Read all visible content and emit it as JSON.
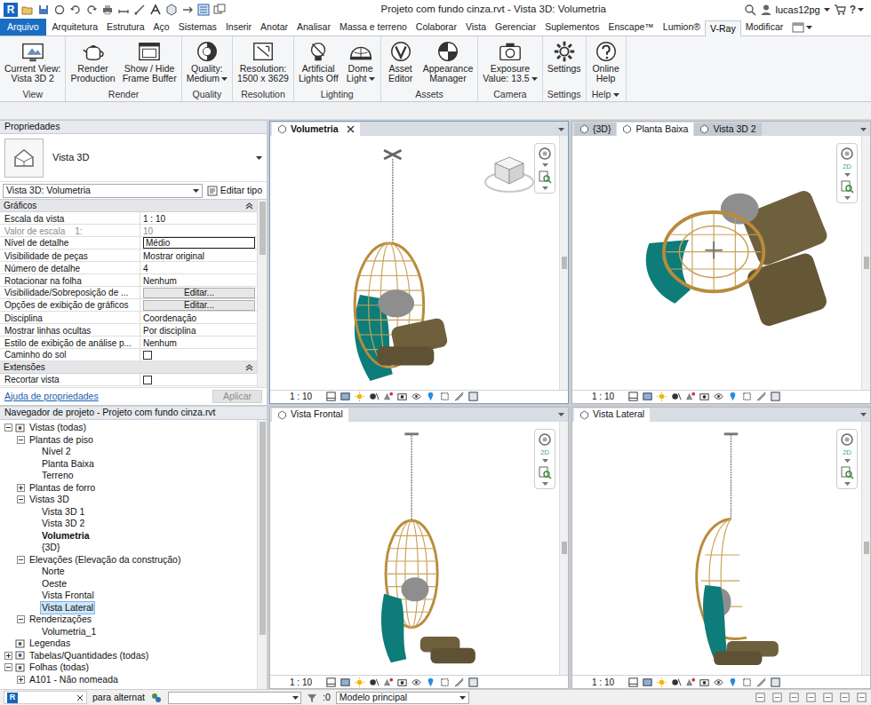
{
  "app": {
    "logo": "R"
  },
  "window": {
    "title": "Projeto com fundo cinza.rvt - Vista 3D: Volumetria",
    "user": "lucas12pg",
    "help": "?"
  },
  "ribbon_tabs": [
    {
      "label": "Arquivo",
      "selected": false,
      "kind": "file"
    },
    {
      "label": "Arquitetura",
      "selected": false,
      "kind": "tab"
    },
    {
      "label": "Estrutura",
      "selected": false,
      "kind": "tab"
    },
    {
      "label": "Aço",
      "selected": false,
      "kind": "tab"
    },
    {
      "label": "Sistemas",
      "selected": false,
      "kind": "tab"
    },
    {
      "label": "Inserir",
      "selected": false,
      "kind": "tab"
    },
    {
      "label": "Anotar",
      "selected": false,
      "kind": "tab"
    },
    {
      "label": "Analisar",
      "selected": false,
      "kind": "tab"
    },
    {
      "label": "Massa e terreno",
      "selected": false,
      "kind": "tab"
    },
    {
      "label": "Colaborar",
      "selected": false,
      "kind": "tab"
    },
    {
      "label": "Vista",
      "selected": false,
      "kind": "tab"
    },
    {
      "label": "Gerenciar",
      "selected": false,
      "kind": "tab"
    },
    {
      "label": "Suplementos",
      "selected": false,
      "kind": "tab"
    },
    {
      "label": "Enscape™",
      "selected": false,
      "kind": "tab"
    },
    {
      "label": "Lumion®",
      "selected": false,
      "kind": "tab"
    },
    {
      "label": "V-Ray",
      "selected": true,
      "kind": "tab"
    },
    {
      "label": "Modificar",
      "selected": false,
      "kind": "tab"
    }
  ],
  "ribbon_panels": [
    {
      "title": "View",
      "title_dropdown": false,
      "buttons": [
        {
          "lines": [
            "Current View:",
            "Vista 3D 2"
          ],
          "dropdown": false
        }
      ]
    },
    {
      "title": "Render",
      "title_dropdown": false,
      "buttons": [
        {
          "lines": [
            "Render",
            "Production"
          ],
          "dropdown": false
        },
        {
          "lines": [
            "Show / Hide",
            "Frame Buffer"
          ],
          "dropdown": false
        }
      ]
    },
    {
      "title": "Quality",
      "title_dropdown": false,
      "buttons": [
        {
          "lines": [
            "Quality:",
            "Medium"
          ],
          "dropdown": true
        }
      ]
    },
    {
      "title": "Resolution",
      "title_dropdown": false,
      "buttons": [
        {
          "lines": [
            "Resolution:",
            "1500 x 3629"
          ],
          "dropdown": false
        }
      ]
    },
    {
      "title": "Lighting",
      "title_dropdown": false,
      "buttons": [
        {
          "lines": [
            "Artificial",
            "Lights Off"
          ],
          "dropdown": false
        },
        {
          "lines": [
            "Dome",
            "Light"
          ],
          "dropdown": true
        }
      ]
    },
    {
      "title": "Assets",
      "title_dropdown": false,
      "buttons": [
        {
          "lines": [
            "Asset",
            "Editor"
          ],
          "dropdown": false
        },
        {
          "lines": [
            "Appearance",
            "Manager"
          ],
          "dropdown": false
        }
      ]
    },
    {
      "title": "Camera",
      "title_dropdown": false,
      "buttons": [
        {
          "lines": [
            "Exposure",
            "Value: 13.5"
          ],
          "dropdown": true
        }
      ]
    },
    {
      "title": "Settings",
      "title_dropdown": false,
      "buttons": [
        {
          "lines": [
            "Settings"
          ],
          "dropdown": false
        }
      ]
    },
    {
      "title": "Help",
      "title_dropdown": true,
      "buttons": [
        {
          "lines": [
            "Online",
            "Help"
          ],
          "dropdown": false
        }
      ]
    }
  ],
  "properties": {
    "title": "Propriedades",
    "type": "Vista 3D",
    "selector": "Vista 3D: Volumetria",
    "edit_type": "Editar tipo",
    "sections": [
      {
        "title": "Gráficos",
        "expanded": true,
        "rows": [
          {
            "label": "Escala da vista",
            "value": "1 : 10",
            "kind": "text",
            "disabled": false
          },
          {
            "label": "Valor de escala    1:",
            "value": "10",
            "kind": "text",
            "disabled": true
          },
          {
            "label": "Nível de detalhe",
            "value": "Médio",
            "kind": "edit",
            "disabled": false
          },
          {
            "label": "Visibilidade de peças",
            "value": "Mostrar original",
            "kind": "text",
            "disabled": false
          },
          {
            "label": "Número de detalhe",
            "value": "4",
            "kind": "text",
            "disabled": false
          },
          {
            "label": "Rotacionar na folha",
            "value": "Nenhum",
            "kind": "text",
            "disabled": false
          },
          {
            "label": "Visibilidade/Sobreposição de ...",
            "value": "Editar...",
            "kind": "button",
            "disabled": false
          },
          {
            "label": "Opções de exibição de gráficos",
            "value": "Editar...",
            "kind": "button",
            "disabled": false
          },
          {
            "label": "Disciplina",
            "value": "Coordenação",
            "kind": "text",
            "disabled": false
          },
          {
            "label": "Mostrar linhas ocultas",
            "value": "Por disciplina",
            "kind": "text",
            "disabled": false
          },
          {
            "label": "Estilo de exibição de análise p...",
            "value": "Nenhum",
            "kind": "text",
            "disabled": false
          },
          {
            "label": "Caminho do sol",
            "checked": false,
            "kind": "checkbox",
            "disabled": false
          }
        ]
      },
      {
        "title": "Extensões",
        "expanded": true,
        "rows": [
          {
            "label": "Recortar vista",
            "checked": false,
            "kind": "checkbox",
            "disabled": false
          }
        ]
      }
    ],
    "help_link": "Ajuda de propriedades",
    "apply": {
      "label": "Aplicar",
      "disabled": true
    }
  },
  "browser": {
    "title": "Navegador de projeto - Projeto com fundo cinza.rvt",
    "items": [
      {
        "label": "Vistas (todas)",
        "depth": 0,
        "kind": "branch",
        "expanded": true,
        "bold": false,
        "selected": false
      },
      {
        "label": "Plantas de piso",
        "depth": 1,
        "kind": "branch",
        "expanded": true,
        "bold": false,
        "selected": false
      },
      {
        "label": "Nível 2",
        "depth": 2,
        "kind": "leaf",
        "expanded": false,
        "bold": false,
        "selected": false
      },
      {
        "label": "Planta Baixa",
        "depth": 2,
        "kind": "leaf",
        "expanded": false,
        "bold": false,
        "selected": false
      },
      {
        "label": "Terreno",
        "depth": 2,
        "kind": "leaf",
        "expanded": false,
        "bold": false,
        "selected": false
      },
      {
        "label": "Plantas de forro",
        "depth": 1,
        "kind": "branch",
        "expanded": false,
        "bold": false,
        "selected": false
      },
      {
        "label": "Vistas 3D",
        "depth": 1,
        "kind": "branch",
        "expanded": true,
        "bold": false,
        "selected": false
      },
      {
        "label": "Vista 3D 1",
        "depth": 2,
        "kind": "leaf",
        "expanded": false,
        "bold": false,
        "selected": false
      },
      {
        "label": "Vista 3D 2",
        "depth": 2,
        "kind": "leaf",
        "expanded": false,
        "bold": false,
        "selected": false
      },
      {
        "label": "Volumetria",
        "depth": 2,
        "kind": "leaf",
        "expanded": false,
        "bold": true,
        "selected": false
      },
      {
        "label": "{3D}",
        "depth": 2,
        "kind": "leaf",
        "expanded": false,
        "bold": false,
        "selected": false
      },
      {
        "label": "Elevações (Elevação da construção)",
        "depth": 1,
        "kind": "branch",
        "expanded": true,
        "bold": false,
        "selected": false
      },
      {
        "label": "Norte",
        "depth": 2,
        "kind": "leaf",
        "expanded": false,
        "bold": false,
        "selected": false
      },
      {
        "label": "Oeste",
        "depth": 2,
        "kind": "leaf",
        "expanded": false,
        "bold": false,
        "selected": false
      },
      {
        "label": "Vista Frontal",
        "depth": 2,
        "kind": "leaf",
        "expanded": false,
        "bold": false,
        "selected": false
      },
      {
        "label": "Vista Lateral",
        "depth": 2,
        "kind": "leaf",
        "expanded": false,
        "bold": false,
        "selected": true
      },
      {
        "label": "Renderizações",
        "depth": 1,
        "kind": "branch",
        "expanded": true,
        "bold": false,
        "selected": false
      },
      {
        "label": "Volumetria_1",
        "depth": 2,
        "kind": "leaf",
        "expanded": false,
        "bold": false,
        "selected": false
      },
      {
        "label": "Legendas",
        "depth": 0,
        "kind": "leaf",
        "expanded": false,
        "bold": false,
        "selected": false
      },
      {
        "label": "Tabelas/Quantidades (todas)",
        "depth": 0,
        "kind": "branch",
        "expanded": false,
        "bold": false,
        "selected": false
      },
      {
        "label": "Folhas (todas)",
        "depth": 0,
        "kind": "branch",
        "expanded": true,
        "bold": false,
        "selected": false
      },
      {
        "label": "A101 - Não nomeada",
        "depth": 1,
        "kind": "branch",
        "expanded": false,
        "bold": false,
        "selected": false
      }
    ]
  },
  "viewports": [
    {
      "tabs": [
        {
          "label": "Volumetria",
          "selected": true,
          "closable": true
        }
      ],
      "active": true,
      "figure": "perspective",
      "viewcube": true,
      "scale": "1 : 10"
    },
    {
      "tabs": [
        {
          "label": "{3D}",
          "selected": false,
          "closable": false
        },
        {
          "label": "Planta Baixa",
          "selected": true,
          "closable": false
        },
        {
          "label": "Vista 3D 2",
          "selected": false,
          "closable": false
        }
      ],
      "active": false,
      "figure": "top",
      "viewcube": false,
      "nav_label": "2D",
      "scale": "1 : 10"
    },
    {
      "tabs": [
        {
          "label": "Vista Frontal",
          "selected": true,
          "closable": false
        }
      ],
      "active": false,
      "figure": "front",
      "viewcube": false,
      "nav_label": "2D",
      "scale": "1 : 10"
    },
    {
      "tabs": [
        {
          "label": "Vista Lateral",
          "selected": true,
          "closable": false
        }
      ],
      "active": false,
      "figure": "side",
      "viewcube": false,
      "nav_label": "2D",
      "scale": "1 : 10"
    }
  ],
  "status_bar": {
    "hint": "para alternat",
    "count": ":0",
    "model": "Modelo principal"
  }
}
